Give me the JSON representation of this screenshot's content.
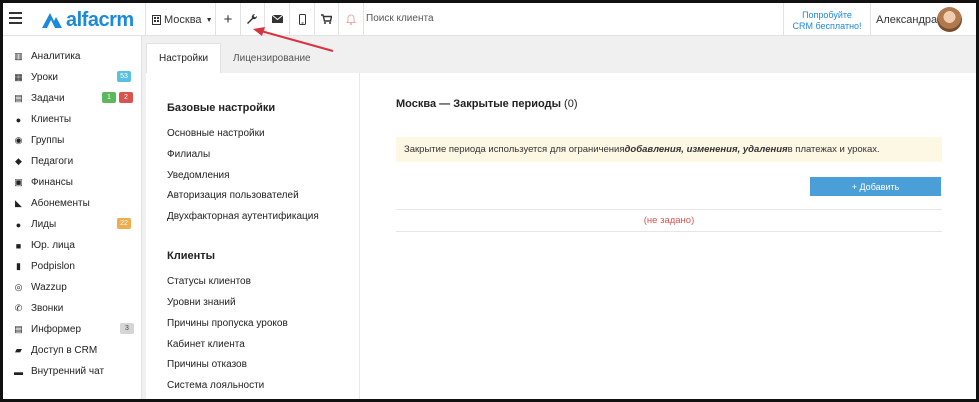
{
  "header": {
    "logo_text": "alfacrm",
    "branch": "Москва",
    "search_placeholder": "Поиск клиента",
    "promo_line1": "Попробуйте",
    "promo_line2": "CRM бесплатно!",
    "user_name": "Александра",
    "icons": [
      "menu-icon",
      "plus-icon",
      "wrench-icon",
      "envelope-icon",
      "phone-icon",
      "cart-icon",
      "bell-icon"
    ]
  },
  "sidebar": {
    "items": [
      {
        "label": "Аналитика",
        "icon": "chart-icon"
      },
      {
        "label": "Уроки",
        "icon": "calendar-icon",
        "badge": "53",
        "badge_color": "#5bc0de"
      },
      {
        "label": "Задачи",
        "icon": "tasks-icon",
        "badge": "1",
        "badge_color": "#5cb85c",
        "badge2": "2",
        "badge2_color": "#d9534f"
      },
      {
        "label": "Клиенты",
        "icon": "user-icon"
      },
      {
        "label": "Группы",
        "icon": "users-icon"
      },
      {
        "label": "Педагоги",
        "icon": "graduation-cap-icon"
      },
      {
        "label": "Финансы",
        "icon": "money-icon"
      },
      {
        "label": "Абонементы",
        "icon": "tag-icon"
      },
      {
        "label": "Лиды",
        "icon": "user-plus-icon",
        "badge": "22",
        "badge_color": "#f0ad4e"
      },
      {
        "label": "Юр. лица",
        "icon": "briefcase-icon"
      },
      {
        "label": "Podpislon",
        "icon": "file-icon"
      },
      {
        "label": "Wazzup",
        "icon": "whatsapp-icon"
      },
      {
        "label": "Звонки",
        "icon": "phone-call-icon"
      },
      {
        "label": "Информер",
        "icon": "clipboard-icon",
        "badge": "3",
        "badge_color": "#d5d5d5"
      },
      {
        "label": "Доступ в CRM",
        "icon": "lock-icon"
      },
      {
        "label": "Внутренний чат",
        "icon": "chat-icon"
      }
    ]
  },
  "tabs": [
    {
      "label": "Настройки",
      "active": true
    },
    {
      "label": "Лицензирование",
      "active": false
    }
  ],
  "settings": {
    "basic_title": "Базовые настройки",
    "basic_links": [
      "Основные настройки",
      "Филиалы",
      "Уведомления",
      "Авторизация пользователей",
      "Двухфакторная аутентификация"
    ],
    "clients_title": "Клиенты",
    "clients_links": [
      "Статусы клиентов",
      "Уровни знаний",
      "Причины пропуска уроков",
      "Кабинет клиента",
      "Причины отказов",
      "Система лояльности"
    ]
  },
  "main": {
    "title": "Москва — Закрытые периоды",
    "count": "(0)",
    "alert_prefix": "Закрытие периода используется для ограничения ",
    "alert_bold": "добавления, изменения, удаления",
    "alert_suffix": " в платежах и уроках.",
    "add_button": "+ Добавить",
    "empty_text": "(не задано)"
  },
  "colors": {
    "brand": "#1c8ad9",
    "button": "#4a9fd8",
    "alert_bg": "#fcf8e3",
    "empty_text": "#d9534f",
    "annotation_arrow": "#d9333f"
  }
}
